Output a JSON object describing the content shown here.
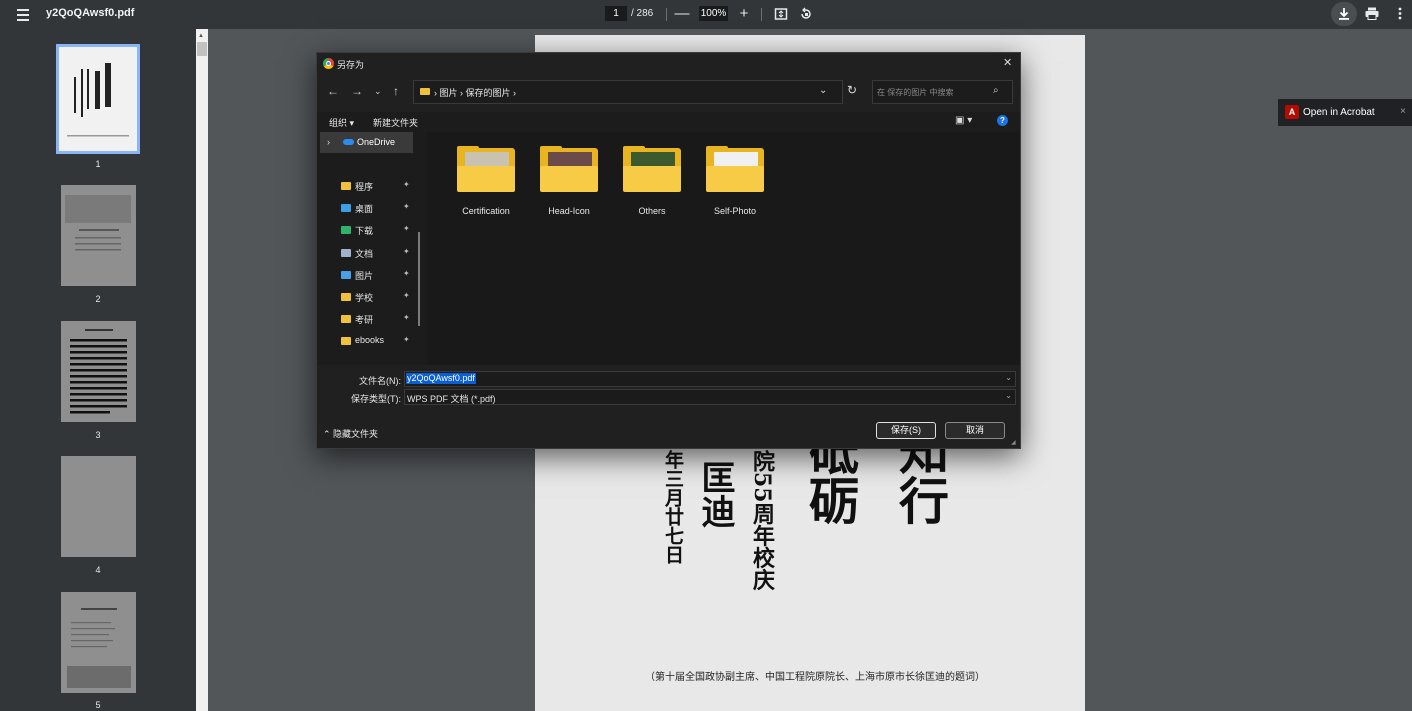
{
  "topbar": {
    "title": "y2QoQAwsf0.pdf",
    "page_current": "1",
    "page_total": "/ 286",
    "zoom": "100%",
    "zoom_out": "—",
    "zoom_in": "+",
    "fit_icon": "fit-page-icon",
    "rotate_icon": "rotate-icon",
    "download_icon": "download-icon",
    "print_icon": "print-icon",
    "more_icon": "more-vertical-icon"
  },
  "sidebar": {
    "thumbnails": [
      "1",
      "2",
      "3",
      "4",
      "5"
    ]
  },
  "page": {
    "calligraphy_col1": "砥砺",
    "calligraphy_col2": "知行",
    "calligraphy_small1": "院55周年校庆",
    "calligraphy_small2": "匡迪",
    "calligraphy_date": "年三月廿七日",
    "caption": "（第十届全国政协副主席、中国工程院原院长、上海市原市长徐匡迪的题词）"
  },
  "acrobat": {
    "label": "Open in Acrobat",
    "close": "×"
  },
  "dialog": {
    "title": "另存为",
    "close": "✕",
    "breadcrumbs": "›  图片  ›  保存的图片  ›",
    "search_placeholder": "在 保存的图片 中搜索",
    "organize": "组织 ▾",
    "new_folder": "新建文件夹",
    "nav_pane": {
      "onedrive": "OneDrive",
      "items": [
        {
          "label": "程序",
          "color": "#f0c23b"
        },
        {
          "label": "桌面",
          "color": "#3aa0e8"
        },
        {
          "label": "下载",
          "color": "#2fb36b"
        },
        {
          "label": "文档",
          "color": "#9fb4cc"
        },
        {
          "label": "图片",
          "color": "#4a9fe8"
        },
        {
          "label": "学校",
          "color": "#f0c23b"
        },
        {
          "label": "考研",
          "color": "#f0c23b"
        },
        {
          "label": "ebooks",
          "color": "#f0c23b"
        }
      ],
      "pin": "📌"
    },
    "folders": [
      "Certification",
      "Head-Icon",
      "Others",
      "Self-Photo"
    ],
    "filename_label": "文件名(N):",
    "filename_value": "y2QoQAwsf0.pdf",
    "filetype_label": "保存类型(T):",
    "filetype_value": "WPS PDF 文档 (*.pdf)",
    "hide_folders": "⌃ 隐藏文件夹",
    "save_button": "保存(S)",
    "cancel_button": "取消"
  },
  "colors": {
    "accent": "#8ab4f8",
    "selection": "#0a5fd6",
    "folder": "#f7cb45"
  }
}
